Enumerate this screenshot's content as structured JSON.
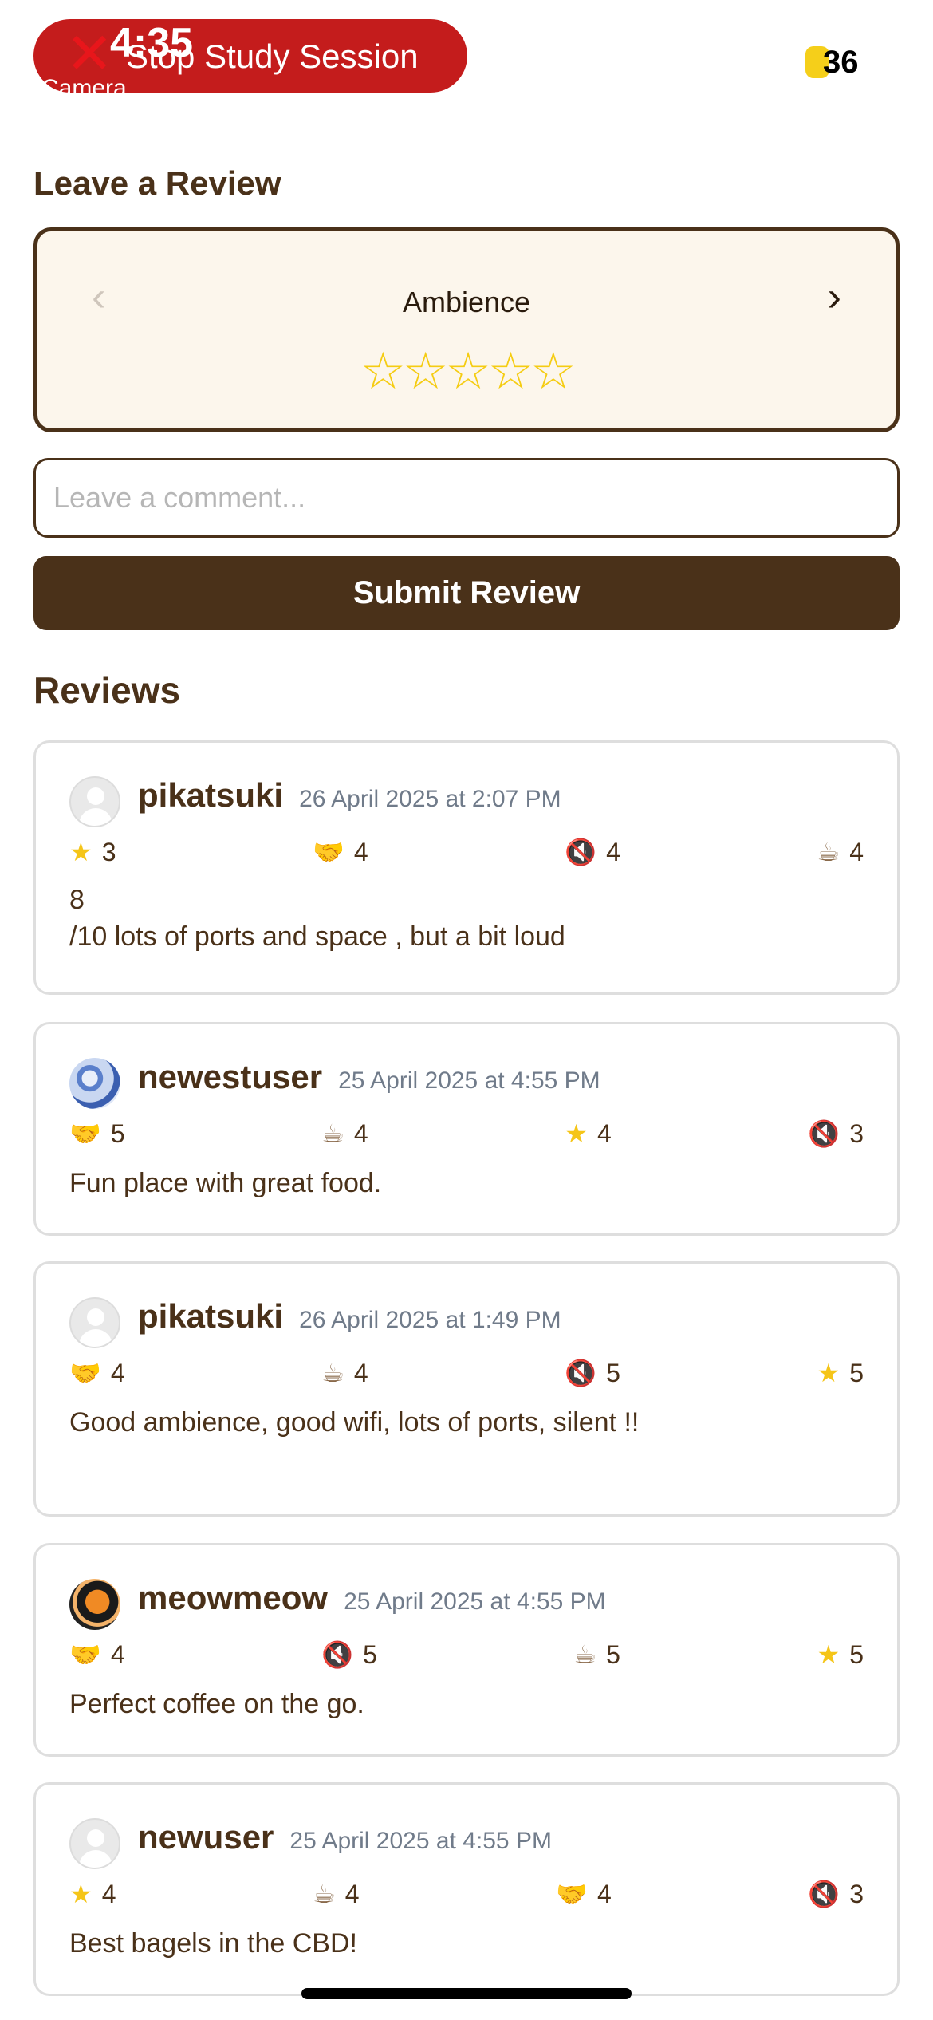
{
  "status_bar": {
    "time": "4:35",
    "stop_session_label": "Stop Study Session",
    "camera_hint": "Camera",
    "battery": "36"
  },
  "review_form": {
    "title": "Leave a Review",
    "category": "Ambience",
    "stars": "☆☆☆☆☆",
    "comment_placeholder": "Leave a comment...",
    "submit_label": "Submit Review"
  },
  "reviews_title": "Reviews",
  "reviews": [
    {
      "username": "pikatsuki",
      "timestamp": "26 April 2025 at 2:07 PM",
      "ratings": [
        {
          "icon": "star-icon",
          "glyph": "★",
          "value": "3"
        },
        {
          "icon": "handshake-icon",
          "glyph": "🤝",
          "value": "4"
        },
        {
          "icon": "quiet-icon",
          "glyph": "🔇",
          "value": "4"
        },
        {
          "icon": "coffee-icon",
          "glyph": "☕",
          "value": "4"
        }
      ],
      "comment": "8\n/10 lots of ports and space , but a bit loud"
    },
    {
      "username": "newestuser",
      "timestamp": "25 April 2025 at 4:55 PM",
      "ratings": [
        {
          "icon": "handshake-icon",
          "glyph": "🤝",
          "value": "5"
        },
        {
          "icon": "coffee-icon",
          "glyph": "☕",
          "value": "4"
        },
        {
          "icon": "star-icon",
          "glyph": "★",
          "value": "4"
        },
        {
          "icon": "quiet-icon",
          "glyph": "🔇",
          "value": "3"
        }
      ],
      "comment": "Fun place with great food."
    },
    {
      "username": "pikatsuki",
      "timestamp": "26 April 2025 at 1:49 PM",
      "ratings": [
        {
          "icon": "handshake-icon",
          "glyph": "🤝",
          "value": "4"
        },
        {
          "icon": "coffee-icon",
          "glyph": "☕",
          "value": "4"
        },
        {
          "icon": "quiet-icon",
          "glyph": "🔇",
          "value": "5"
        },
        {
          "icon": "star-icon",
          "glyph": "★",
          "value": "5"
        }
      ],
      "comment": "Good ambience, good wifi, lots of ports, silent !!"
    },
    {
      "username": "meowmeow",
      "timestamp": "25 April 2025 at 4:55 PM",
      "ratings": [
        {
          "icon": "handshake-icon",
          "glyph": "🤝",
          "value": "4"
        },
        {
          "icon": "quiet-icon",
          "glyph": "🔇",
          "value": "5"
        },
        {
          "icon": "coffee-icon",
          "glyph": "☕",
          "value": "5"
        },
        {
          "icon": "star-icon",
          "glyph": "★",
          "value": "5"
        }
      ],
      "comment": "Perfect coffee on the go."
    },
    {
      "username": "newuser",
      "timestamp": "25 April 2025 at 4:55 PM",
      "ratings": [
        {
          "icon": "star-icon",
          "glyph": "★",
          "value": "4"
        },
        {
          "icon": "coffee-icon",
          "glyph": "☕",
          "value": "4"
        },
        {
          "icon": "handshake-icon",
          "glyph": "🤝",
          "value": "4"
        },
        {
          "icon": "quiet-icon",
          "glyph": "🔇",
          "value": "3"
        }
      ],
      "comment": "Best bagels in the CBD!"
    }
  ]
}
